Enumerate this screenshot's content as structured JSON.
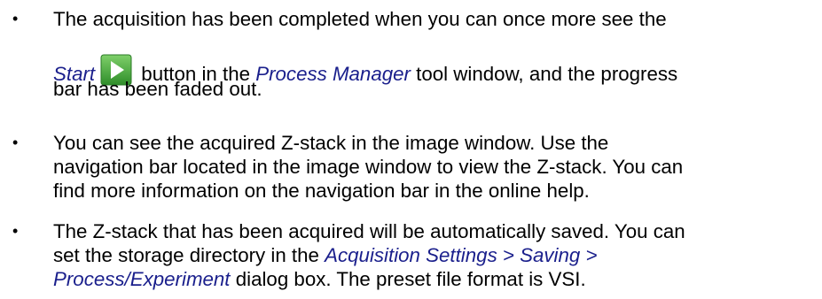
{
  "bullets": [
    {
      "line1": "The acquisition has been completed when you can once more see the",
      "line2_start": "Start",
      "line2_mid": " button in the ",
      "line2_pm": "Process Manager",
      "line2_end": " tool window, and the progress",
      "line3": "bar has been faded out."
    },
    {
      "line1": "You can see the acquired Z-stack in the image window. Use the",
      "line2": "navigation bar located in the image window to view the Z-stack. You can",
      "line3": "find more information on the navigation bar in the online help."
    },
    {
      "line1": "The Z-stack that has been acquired will be automatically saved. You can",
      "line2_pre": "set the storage directory in the ",
      "line2_link": "Acquisition Settings > Saving >",
      "line3_link": "Process/Experiment",
      "line3_post": " dialog box. The preset file format is VSI."
    }
  ],
  "icons": {
    "start": "play-icon",
    "bullet_glyph": "•"
  },
  "colors": {
    "link": "#1a1f8c",
    "start_icon_bg": "#4aa83a",
    "start_icon_arrow": "#ffffff"
  }
}
